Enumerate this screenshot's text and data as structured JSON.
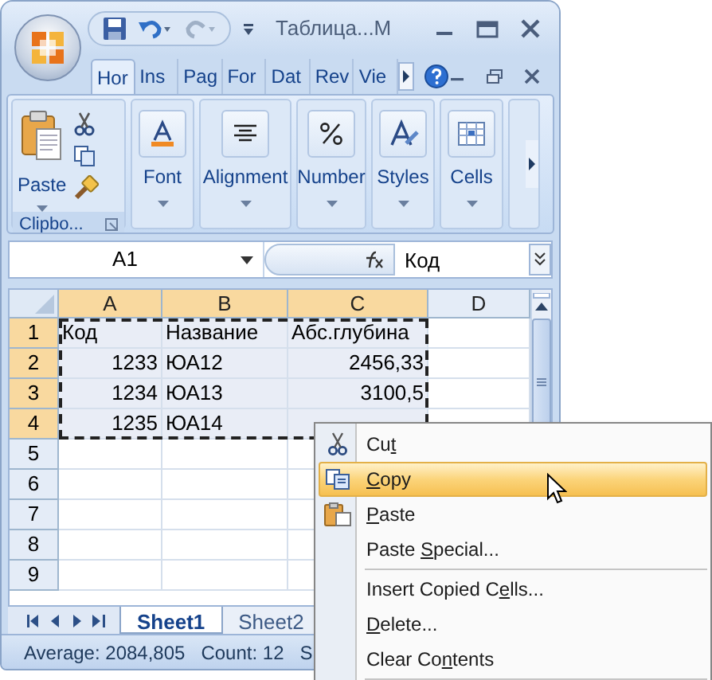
{
  "title_bar": {
    "title": "Таблица...M"
  },
  "ribbon_tabs": [
    {
      "label": "Hor",
      "selected": true
    },
    {
      "label": "Ins",
      "selected": false
    },
    {
      "label": "Pag",
      "selected": false
    },
    {
      "label": "For",
      "selected": false
    },
    {
      "label": "Dat",
      "selected": false
    },
    {
      "label": "Rev",
      "selected": false
    },
    {
      "label": "Vie",
      "selected": false
    }
  ],
  "ribbon_groups": [
    {
      "kind": "clipboard",
      "button": "Paste",
      "label": "Clipbo..."
    },
    {
      "kind": "font",
      "button": "Font"
    },
    {
      "kind": "alignment",
      "button": "Alignment"
    },
    {
      "kind": "number",
      "button": "Number"
    },
    {
      "kind": "styles",
      "button": "Styles"
    },
    {
      "kind": "cells",
      "button": "Cells"
    }
  ],
  "formula_bar": {
    "name_box": "A1",
    "value": "Код"
  },
  "columns": [
    {
      "label": "A",
      "selected": true
    },
    {
      "label": "B",
      "selected": true
    },
    {
      "label": "C",
      "selected": true
    },
    {
      "label": "D",
      "selected": false
    }
  ],
  "rows": [
    {
      "label": "1",
      "selected": true,
      "cells": [
        {
          "text": "Код",
          "kind": "text"
        },
        {
          "text": "Название",
          "kind": "text"
        },
        {
          "text": "Абс.глубина",
          "kind": "text"
        }
      ]
    },
    {
      "label": "2",
      "selected": true,
      "cells": [
        {
          "text": "1233",
          "kind": "number"
        },
        {
          "text": "ЮА12",
          "kind": "text"
        },
        {
          "text": "2456,33",
          "kind": "number"
        }
      ]
    },
    {
      "label": "3",
      "selected": true,
      "cells": [
        {
          "text": "1234",
          "kind": "number"
        },
        {
          "text": "ЮА13",
          "kind": "text"
        },
        {
          "text": "3100,5",
          "kind": "number"
        }
      ]
    },
    {
      "label": "4",
      "selected": true,
      "cells": [
        {
          "text": "1235",
          "kind": "number"
        },
        {
          "text": "ЮА14",
          "kind": "text"
        }
      ]
    },
    {
      "label": "5",
      "selected": false
    },
    {
      "label": "6",
      "selected": false
    },
    {
      "label": "7",
      "selected": false
    },
    {
      "label": "8",
      "selected": false
    },
    {
      "label": "9",
      "selected": false
    }
  ],
  "sheet_tabs": [
    {
      "label": "Sheet1",
      "selected": true
    },
    {
      "label": "Sheet2",
      "selected": false
    }
  ],
  "status_bar": [
    "Average: 2084,805",
    "Count: 12",
    "S"
  ],
  "context_menu": [
    {
      "kind": "cut",
      "before": "Cu",
      "key": "t",
      "selected": false
    },
    {
      "kind": "copy",
      "key": "C",
      "after": "opy",
      "selected": true
    },
    {
      "kind": "paste",
      "key": "P",
      "after": "aste",
      "selected": false
    },
    {
      "kind": "plain",
      "before": "Paste ",
      "key": "S",
      "after": "pecial...",
      "selected": false
    },
    {
      "kind": "separator"
    },
    {
      "kind": "plain",
      "before": "Insert Copied C",
      "key": "e",
      "after": "lls...",
      "selected": false
    },
    {
      "kind": "plain",
      "key": "D",
      "after": "elete...",
      "selected": false
    },
    {
      "kind": "plain",
      "before": "Clear Co",
      "key": "n",
      "after": "tents",
      "selected": false
    },
    {
      "kind": "separator"
    }
  ]
}
